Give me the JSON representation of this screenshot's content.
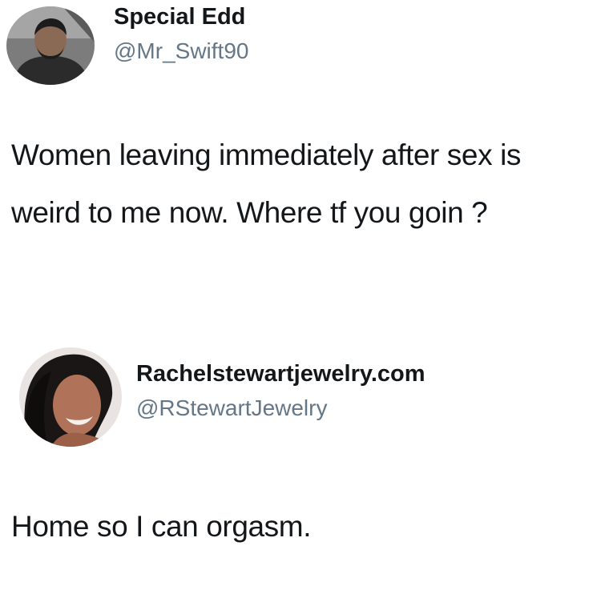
{
  "tweets": [
    {
      "display_name": "Special Edd",
      "handle": "@Mr_Swift90",
      "text": "Women leaving immediately after sex is weird to me now. Where tf you goin ?"
    },
    {
      "display_name": "Rachelstewartjewelry.com",
      "handle": "@RStewartJewelry",
      "text": "Home so I can orgasm."
    }
  ]
}
